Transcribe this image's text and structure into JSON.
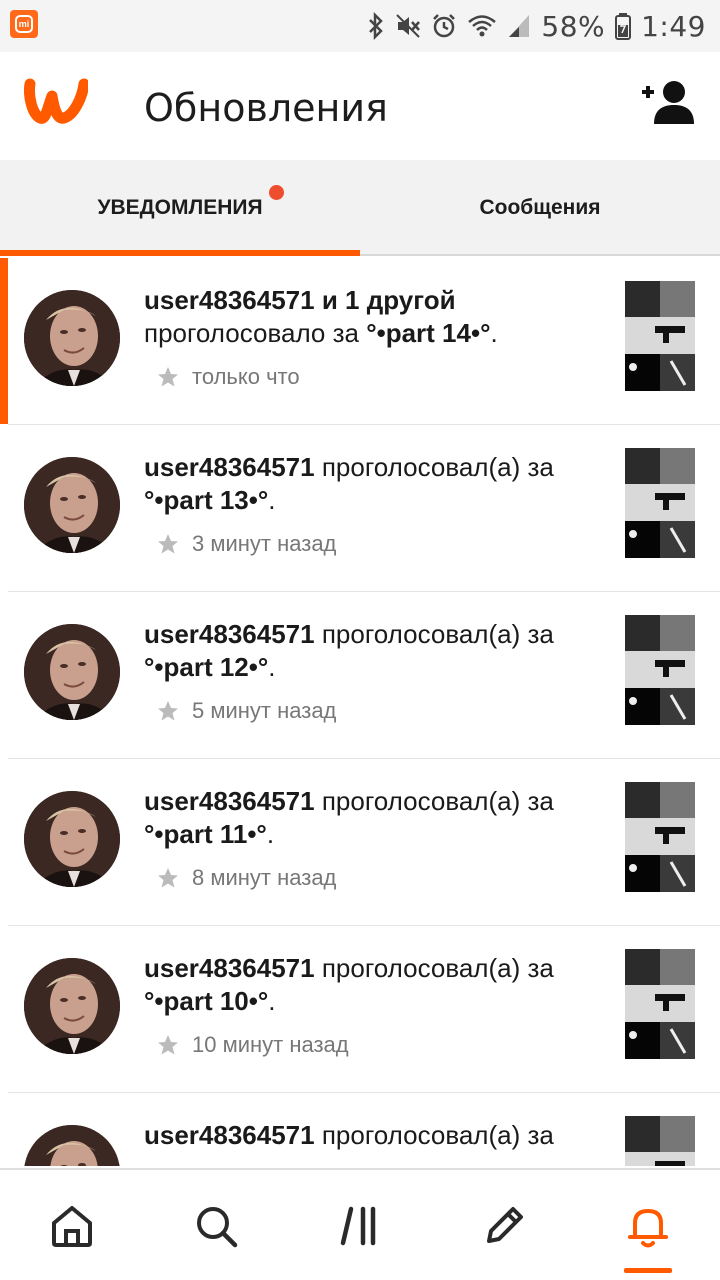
{
  "status_bar": {
    "battery": "58%",
    "time": "1:49"
  },
  "app_bar": {
    "title": "Обновления"
  },
  "tabs": [
    {
      "label": "УВЕДОМЛЕНИЯ",
      "active": true,
      "has_badge": true
    },
    {
      "label": "Сообщения",
      "active": false
    }
  ],
  "notifications": [
    {
      "user": "user48364571 и 1 другой",
      "action": "проголосовало за",
      "part": "°•part 14•°",
      "suffix": ".",
      "time": "только что"
    },
    {
      "user": "user48364571",
      "action": "проголосовал(а) за",
      "part": "°•part 13•°",
      "suffix": ".",
      "time": "3 минут назад"
    },
    {
      "user": "user48364571",
      "action": "проголосовал(а) за",
      "part": "°•part 12•°",
      "suffix": ".",
      "time": "5 минут назад"
    },
    {
      "user": "user48364571",
      "action": "проголосовал(а) за",
      "part": "°•part 11•°",
      "suffix": ".",
      "time": "8 минут назад"
    },
    {
      "user": "user48364571",
      "action": "проголосовал(а) за",
      "part": "°•part 10•°",
      "suffix": ".",
      "time": "10 минут назад"
    },
    {
      "user": "user48364571",
      "action": "проголосовал(а) за",
      "part": "",
      "suffix": "",
      "time": ""
    }
  ],
  "bottom_nav": [
    {
      "icon": "home-icon",
      "active": false
    },
    {
      "icon": "search-icon",
      "active": false
    },
    {
      "icon": "library-icon",
      "active": false
    },
    {
      "icon": "write-icon",
      "active": false
    },
    {
      "icon": "notifications-icon",
      "active": true
    }
  ],
  "colors": {
    "accent": "#ff5a00",
    "badge": "#ee4d2e"
  }
}
